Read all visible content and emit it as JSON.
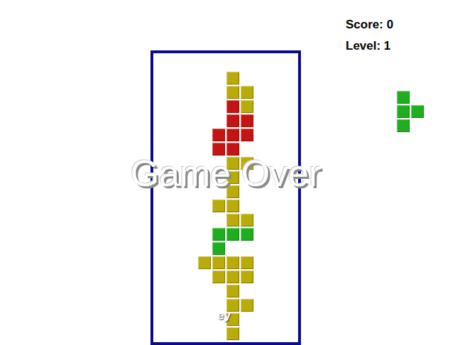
{
  "score_label": "Score: 0",
  "level_label": "Level: 1",
  "board": {
    "rows": 20,
    "cols": 10,
    "cells": [
      {
        "row": 1,
        "col": 5,
        "color": "#b8ab0a"
      },
      {
        "row": 2,
        "col": 5,
        "color": "#b8ab0a"
      },
      {
        "row": 2,
        "col": 6,
        "color": "#b8ab0a"
      },
      {
        "row": 3,
        "col": 5,
        "color": "#c41414"
      },
      {
        "row": 3,
        "col": 6,
        "color": "#b8ab0a"
      },
      {
        "row": 4,
        "col": 5,
        "color": "#c41414"
      },
      {
        "row": 4,
        "col": 6,
        "color": "#c41414"
      },
      {
        "row": 5,
        "col": 4,
        "color": "#c41414"
      },
      {
        "row": 5,
        "col": 5,
        "color": "#c41414"
      },
      {
        "row": 5,
        "col": 6,
        "color": "#c41414"
      },
      {
        "row": 6,
        "col": 4,
        "color": "#c41414"
      },
      {
        "row": 6,
        "col": 5,
        "color": "#c41414"
      },
      {
        "row": 7,
        "col": 5,
        "color": "#b8ab0a"
      },
      {
        "row": 7,
        "col": 6,
        "color": "#b8ab0a"
      },
      {
        "row": 8,
        "col": 5,
        "color": "#b8ab0a"
      },
      {
        "row": 9,
        "col": 5,
        "color": "#b8ab0a"
      },
      {
        "row": 10,
        "col": 4,
        "color": "#b8ab0a"
      },
      {
        "row": 10,
        "col": 5,
        "color": "#b8ab0a"
      },
      {
        "row": 11,
        "col": 5,
        "color": "#b8ab0a"
      },
      {
        "row": 11,
        "col": 6,
        "color": "#b8ab0a"
      },
      {
        "row": 12,
        "col": 4,
        "color": "#1fae1f"
      },
      {
        "row": 12,
        "col": 5,
        "color": "#1fae1f"
      },
      {
        "row": 12,
        "col": 6,
        "color": "#1fae1f"
      },
      {
        "row": 13,
        "col": 4,
        "color": "#1fae1f"
      },
      {
        "row": 14,
        "col": 3,
        "color": "#b8ab0a"
      },
      {
        "row": 14,
        "col": 4,
        "color": "#b8ab0a"
      },
      {
        "row": 14,
        "col": 5,
        "color": "#b8ab0a"
      },
      {
        "row": 14,
        "col": 6,
        "color": "#b8ab0a"
      },
      {
        "row": 15,
        "col": 4,
        "color": "#b8ab0a"
      },
      {
        "row": 15,
        "col": 5,
        "color": "#b8ab0a"
      },
      {
        "row": 15,
        "col": 6,
        "color": "#b8ab0a"
      },
      {
        "row": 16,
        "col": 5,
        "color": "#b8ab0a"
      },
      {
        "row": 17,
        "col": 5,
        "color": "#b8ab0a"
      },
      {
        "row": 17,
        "col": 6,
        "color": "#b8ab0a"
      },
      {
        "row": 18,
        "col": 5,
        "color": "#b8ab0a"
      },
      {
        "row": 19,
        "col": 5,
        "color": "#b8ab0a"
      }
    ]
  },
  "next_piece": {
    "color": "#1fae1f",
    "cells": [
      {
        "row": 0,
        "col": 0
      },
      {
        "row": 1,
        "col": 0
      },
      {
        "row": 1,
        "col": 1
      },
      {
        "row": 2,
        "col": 0
      }
    ]
  },
  "overlay": {
    "title": "Game Over",
    "hint": "ey"
  }
}
